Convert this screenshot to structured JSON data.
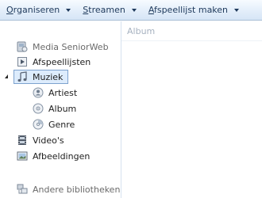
{
  "toolbar": {
    "organize": {
      "first": "O",
      "rest": "rganiseren"
    },
    "stream": {
      "first": "S",
      "rest": "treamen"
    },
    "playlist": {
      "first": "A",
      "rest": "fspeellijst maken"
    }
  },
  "nav": {
    "media_seniorweb": "Media SeniorWeb",
    "playlists": "Afspeellijsten",
    "music": "Muziek",
    "artist": "Artiest",
    "album": "Album",
    "genre": "Genre",
    "videos": "Video's",
    "pictures": "Afbeeldingen",
    "other_libraries": "Andere bibliotheken"
  },
  "content": {
    "column_header": "Album"
  },
  "colors": {
    "selection_bg": "#ddecfc",
    "selection_border": "#7da2ce",
    "toolbar_text": "#1e395b",
    "header_text": "#a7b2c0"
  }
}
